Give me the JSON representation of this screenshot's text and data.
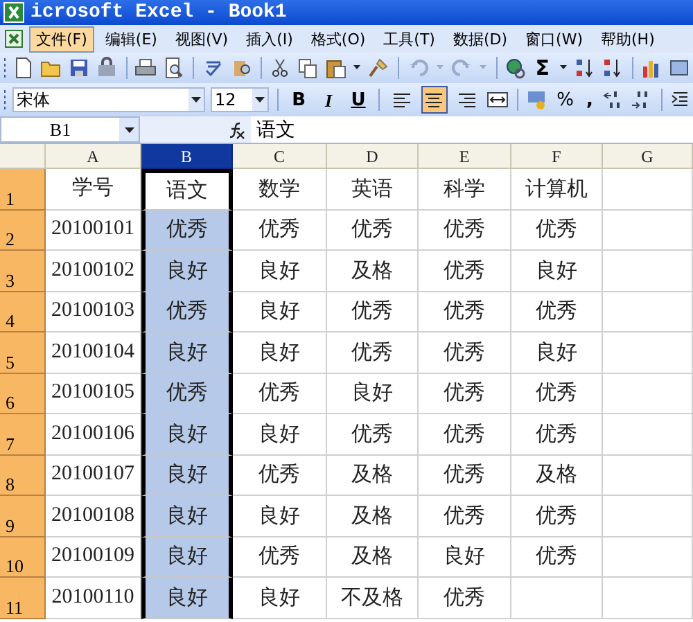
{
  "window": {
    "title": "icrosoft Excel - Book1"
  },
  "menu": [
    {
      "label": "文件(F)",
      "selected": true
    },
    {
      "label": "编辑(E)",
      "selected": false
    },
    {
      "label": "视图(V)",
      "selected": false
    },
    {
      "label": "插入(I)",
      "selected": false
    },
    {
      "label": "格式(O)",
      "selected": false
    },
    {
      "label": "工具(T)",
      "selected": false
    },
    {
      "label": "数据(D)",
      "selected": false
    },
    {
      "label": "窗口(W)",
      "selected": false
    },
    {
      "label": "帮助(H)",
      "selected": false
    }
  ],
  "standard_toolbar": {
    "autosum": "Σ"
  },
  "format_toolbar": {
    "font": "宋体",
    "size": "12",
    "styles": [
      {
        "label": "B",
        "kind": "bold"
      },
      {
        "label": "I",
        "kind": "italic"
      },
      {
        "label": "U",
        "kind": "underline"
      }
    ],
    "alignment": [
      {
        "kind": "left",
        "selected": false
      },
      {
        "kind": "center",
        "selected": true
      },
      {
        "kind": "right",
        "selected": false
      }
    ],
    "percent": "%",
    "comma": ","
  },
  "formula_bar": {
    "name_box": "B1",
    "content": "语文"
  },
  "sheet": {
    "columns": [
      {
        "label": "A",
        "selected": false
      },
      {
        "label": "B",
        "selected": true
      },
      {
        "label": "C",
        "selected": false
      },
      {
        "label": "D",
        "selected": false
      },
      {
        "label": "E",
        "selected": false
      },
      {
        "label": "F",
        "selected": false
      },
      {
        "label": "G",
        "selected": false
      }
    ],
    "rows": [
      {
        "label": "1",
        "selected": true,
        "active": true,
        "cells": [
          "学号",
          "语文",
          "数学",
          "英语",
          "科学",
          "计算机"
        ]
      },
      {
        "label": "2",
        "selected": true,
        "active": false,
        "cells": [
          "20100101",
          "优秀",
          "优秀",
          "优秀",
          "优秀",
          "优秀"
        ]
      },
      {
        "label": "3",
        "selected": true,
        "active": false,
        "cells": [
          "20100102",
          "良好",
          "良好",
          "及格",
          "优秀",
          "良好"
        ]
      },
      {
        "label": "4",
        "selected": true,
        "active": false,
        "cells": [
          "20100103",
          "优秀",
          "良好",
          "优秀",
          "优秀",
          "优秀"
        ]
      },
      {
        "label": "5",
        "selected": true,
        "active": false,
        "cells": [
          "20100104",
          "良好",
          "良好",
          "优秀",
          "优秀",
          "良好"
        ]
      },
      {
        "label": "6",
        "selected": true,
        "active": false,
        "cells": [
          "20100105",
          "优秀",
          "优秀",
          "良好",
          "优秀",
          "优秀"
        ]
      },
      {
        "label": "7",
        "selected": true,
        "active": false,
        "cells": [
          "20100106",
          "良好",
          "良好",
          "优秀",
          "优秀",
          "优秀"
        ]
      },
      {
        "label": "8",
        "selected": true,
        "active": false,
        "cells": [
          "20100107",
          "良好",
          "优秀",
          "及格",
          "优秀",
          "及格"
        ]
      },
      {
        "label": "9",
        "selected": true,
        "active": false,
        "cells": [
          "20100108",
          "良好",
          "良好",
          "及格",
          "优秀",
          "优秀"
        ]
      },
      {
        "label": "10",
        "selected": true,
        "active": false,
        "cells": [
          "20100109",
          "良好",
          "优秀",
          "及格",
          "良好",
          "优秀"
        ]
      },
      {
        "label": "11",
        "selected": true,
        "active": false,
        "cells": [
          "20100110",
          "良好",
          "良好",
          "不及格",
          "优秀"
        ]
      }
    ]
  }
}
